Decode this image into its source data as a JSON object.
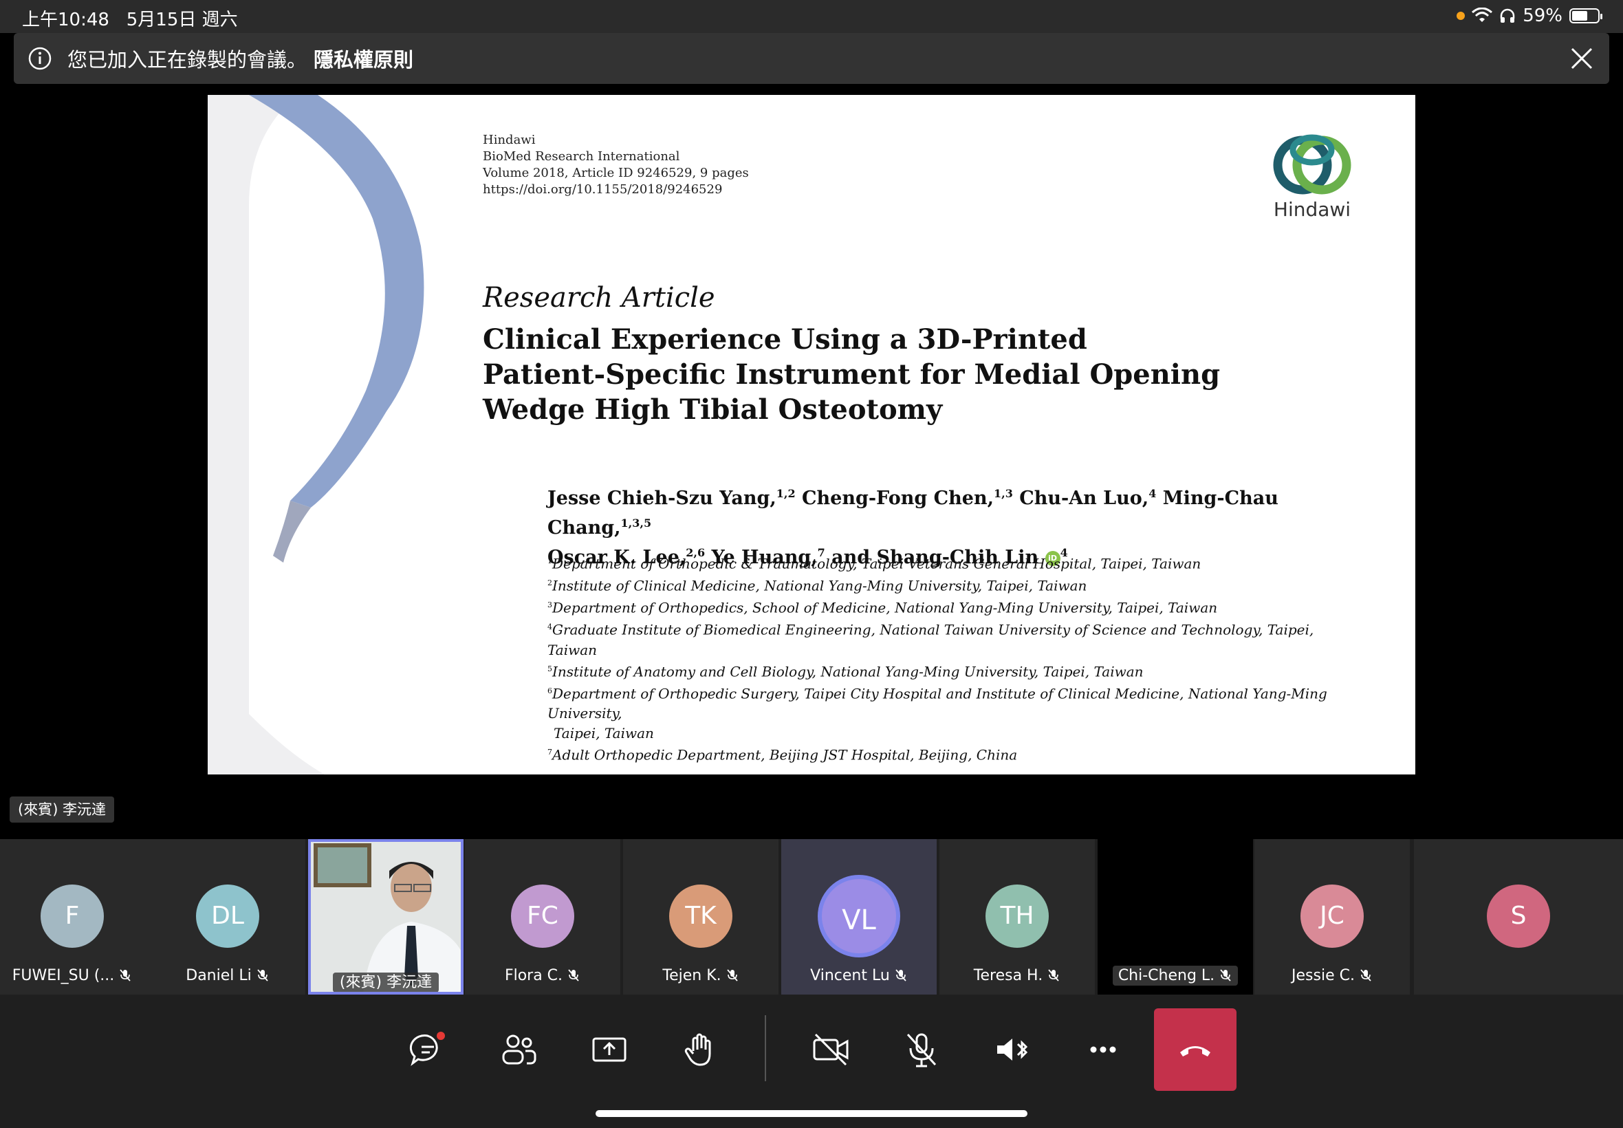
{
  "status_bar": {
    "time": "上午10:48",
    "date": "5月15日 週六",
    "battery": "59%",
    "battery_level": 0.59
  },
  "banner": {
    "message": "您已加入正在錄製的會議。",
    "link": "隱私權原則"
  },
  "slide": {
    "publisher_lines": [
      "Hindawi",
      "BioMed Research International",
      "Volume 2018, Article ID 9246529, 9 pages",
      "https://doi.org/10.1155/2018/9246529"
    ],
    "logo_text": "Hindawi",
    "article_type": "Research Article",
    "title_lines": [
      "Clinical Experience Using a 3D-Printed",
      "Patient-Specific Instrument for Medial Opening",
      "Wedge High Tibial Osteotomy"
    ],
    "authors": [
      {
        "name": "Jesse Chieh-Szu Yang,",
        "sup": "1,2"
      },
      {
        "name": "Cheng-Fong Chen,",
        "sup": "1,3"
      },
      {
        "name": "Chu-An Luo,",
        "sup": "4"
      },
      {
        "name": "Ming-Chau Chang,",
        "sup": "1,3,5"
      },
      {
        "name": "Oscar K. Lee,",
        "sup": "2,6"
      },
      {
        "name": "Ye Huang,",
        "sup": "7"
      },
      {
        "name": "and Shang-Chih Lin",
        "sup": "4"
      }
    ],
    "affiliations": [
      {
        "num": "1",
        "text": "Department of Orthopedic & Traumatology, Taipei Veterans General Hospital, Taipei, Taiwan"
      },
      {
        "num": "2",
        "text": "Institute of Clinical Medicine, National Yang-Ming University, Taipei, Taiwan"
      },
      {
        "num": "3",
        "text": "Department of Orthopedics, School of Medicine, National Yang-Ming University, Taipei, Taiwan"
      },
      {
        "num": "4",
        "text": "Graduate Institute of Biomedical Engineering, National Taiwan University of Science and Technology, Taipei, Taiwan"
      },
      {
        "num": "5",
        "text": "Institute of Anatomy and Cell Biology, National Yang-Ming University, Taipei, Taiwan"
      },
      {
        "num": "6",
        "text": "Department of Orthopedic Surgery, Taipei City Hospital and Institute of Clinical Medicine, National Yang-Ming University,"
      },
      {
        "num": "",
        "text": "Taipei, Taiwan"
      },
      {
        "num": "7",
        "text": "Adult Orthopedic Department, Beijing JST Hospital, Beijing, China"
      }
    ]
  },
  "presenter_label": "(來賓) 李沅達",
  "participants": [
    {
      "initials": "F",
      "name": "FUWEI_SU (...",
      "color": "#a3b8c2",
      "type": "avatar"
    },
    {
      "initials": "DL",
      "name": "Daniel Li",
      "color": "#8ec3cc",
      "type": "avatar"
    },
    {
      "initials": "",
      "name": "(來賓) 李沅達",
      "color": "",
      "type": "video"
    },
    {
      "initials": "FC",
      "name": "Flora C.",
      "color": "#c19ad0",
      "type": "avatar"
    },
    {
      "initials": "TK",
      "name": "Tejen K.",
      "color": "#d99b78",
      "type": "avatar"
    },
    {
      "initials": "VL",
      "name": "Vincent Lu",
      "color": "#9b8ce6",
      "type": "active"
    },
    {
      "initials": "TH",
      "name": "Teresa H.",
      "color": "#90bfae",
      "type": "avatar"
    },
    {
      "initials": "",
      "name": "Chi-Cheng L.",
      "color": "",
      "type": "black"
    },
    {
      "initials": "JC",
      "name": "Jessie C.",
      "color": "#d98a97",
      "type": "avatar"
    },
    {
      "initials": "S",
      "name": "",
      "color": "#d0677f",
      "type": "avatar"
    }
  ],
  "controls": {
    "icons": [
      "chat-icon",
      "participants-icon",
      "share-icon",
      "raise-hand-icon",
      "camera-off-icon",
      "mic-off-icon",
      "speaker-bluetooth-icon",
      "more-icon",
      "hang-up-icon"
    ],
    "hangup_color": "#c4314b",
    "accent": "#7b83eb"
  }
}
